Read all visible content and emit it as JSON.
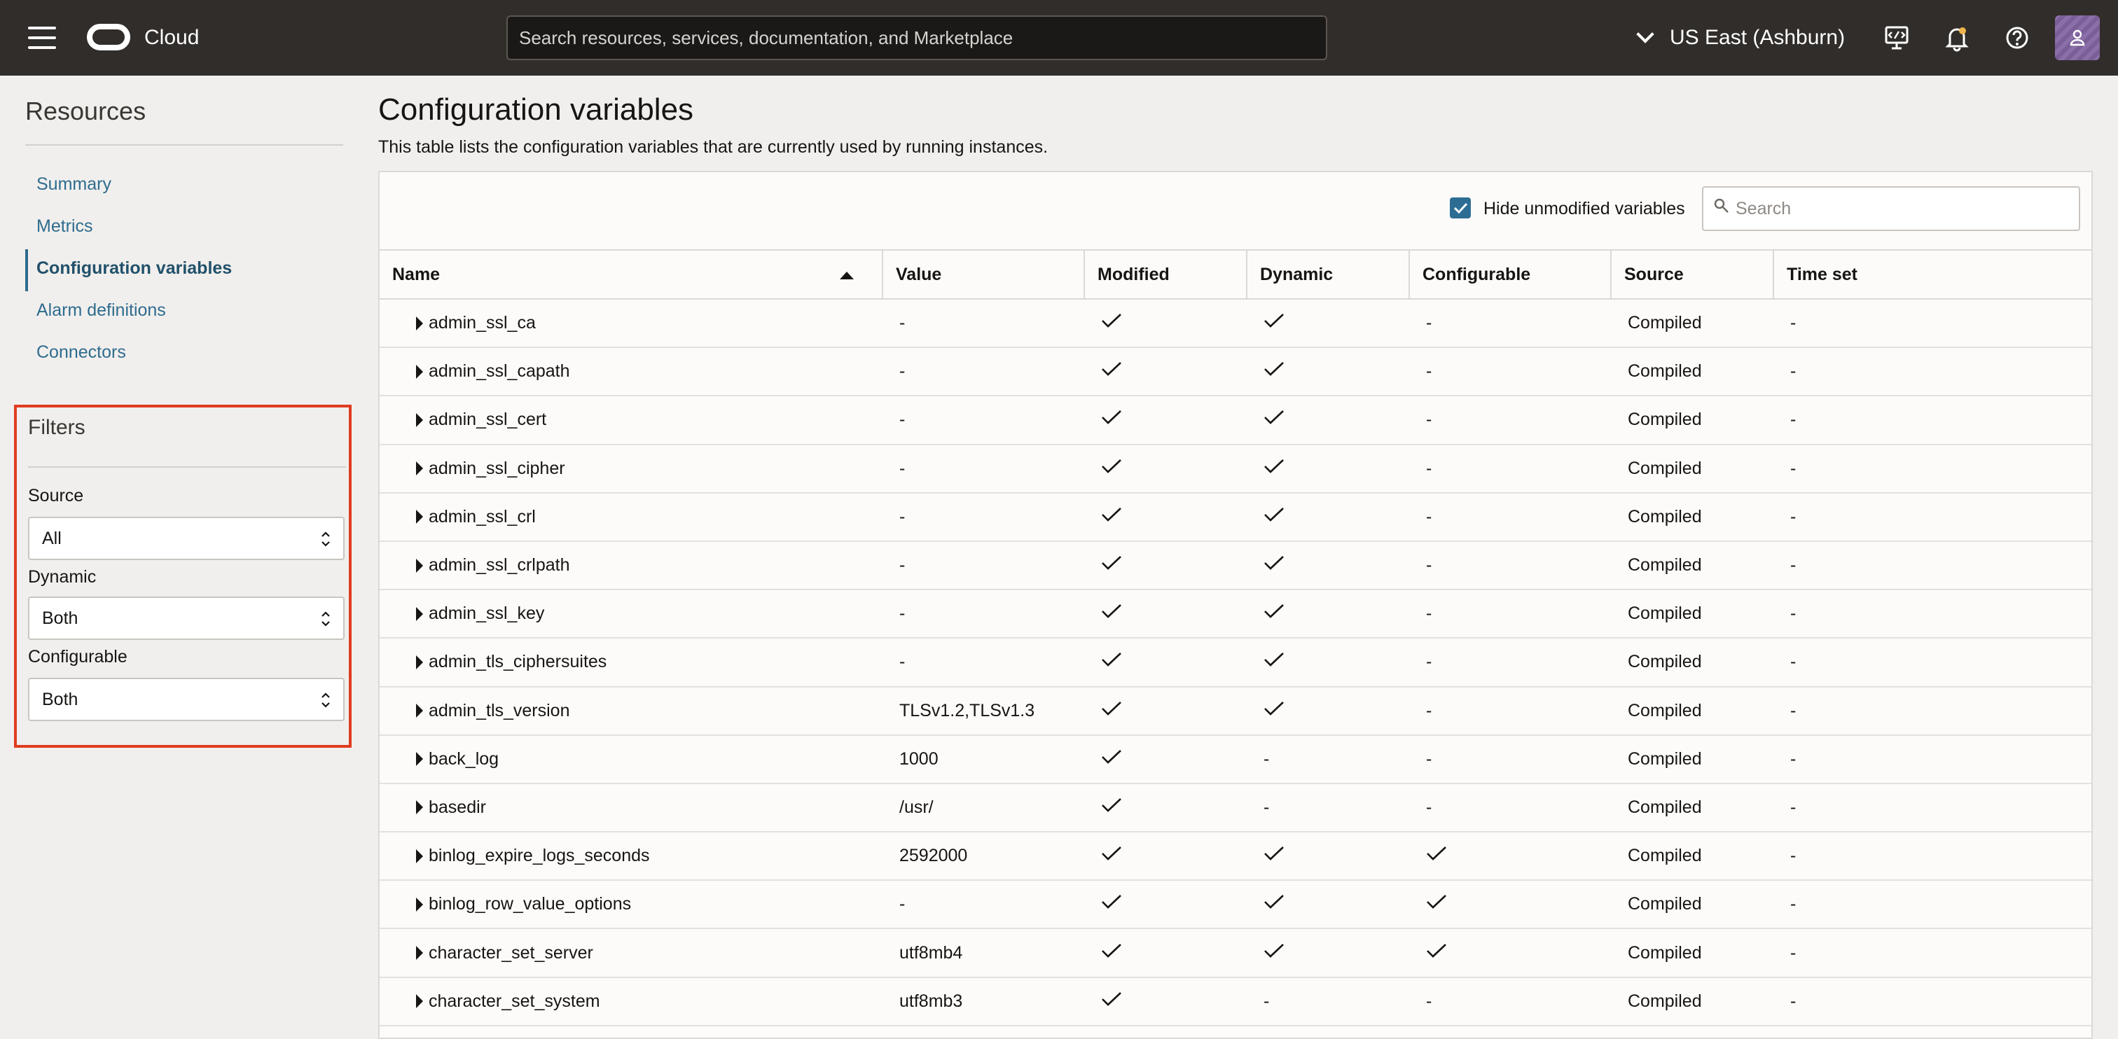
{
  "header": {
    "brand": "Cloud",
    "search_placeholder": "Search resources, services, documentation, and Marketplace",
    "region": "US East (Ashburn)",
    "icons": [
      "menu-icon",
      "oracle-logo-icon",
      "cloud-shell-icon",
      "bell-icon",
      "help-icon",
      "user-avatar-icon"
    ]
  },
  "sidebar": {
    "title": "Resources",
    "items": [
      {
        "label": "Summary",
        "active": false
      },
      {
        "label": "Metrics",
        "active": false
      },
      {
        "label": "Configuration variables",
        "active": true
      },
      {
        "label": "Alarm definitions",
        "active": false
      },
      {
        "label": "Connectors",
        "active": false
      }
    ],
    "filters": {
      "title": "Filters",
      "source_label": "Source",
      "source_value": "All",
      "dynamic_label": "Dynamic",
      "dynamic_value": "Both",
      "configurable_label": "Configurable",
      "configurable_value": "Both"
    }
  },
  "main": {
    "title": "Configuration variables",
    "description": "This table lists the configuration variables that are currently used by running instances.",
    "hide_unmodified_label": "Hide unmodified variables",
    "hide_unmodified_checked": true,
    "search_placeholder": "Search",
    "columns": [
      "Name",
      "Value",
      "Modified",
      "Dynamic",
      "Configurable",
      "Source",
      "Time set"
    ],
    "rows": [
      {
        "name": "admin_ssl_ca",
        "value": "-",
        "modified": true,
        "dynamic": true,
        "configurable": false,
        "source": "Compiled",
        "time_set": "-"
      },
      {
        "name": "admin_ssl_capath",
        "value": "-",
        "modified": true,
        "dynamic": true,
        "configurable": false,
        "source": "Compiled",
        "time_set": "-"
      },
      {
        "name": "admin_ssl_cert",
        "value": "-",
        "modified": true,
        "dynamic": true,
        "configurable": false,
        "source": "Compiled",
        "time_set": "-"
      },
      {
        "name": "admin_ssl_cipher",
        "value": "-",
        "modified": true,
        "dynamic": true,
        "configurable": false,
        "source": "Compiled",
        "time_set": "-"
      },
      {
        "name": "admin_ssl_crl",
        "value": "-",
        "modified": true,
        "dynamic": true,
        "configurable": false,
        "source": "Compiled",
        "time_set": "-"
      },
      {
        "name": "admin_ssl_crlpath",
        "value": "-",
        "modified": true,
        "dynamic": true,
        "configurable": false,
        "source": "Compiled",
        "time_set": "-"
      },
      {
        "name": "admin_ssl_key",
        "value": "-",
        "modified": true,
        "dynamic": true,
        "configurable": false,
        "source": "Compiled",
        "time_set": "-"
      },
      {
        "name": "admin_tls_ciphersuites",
        "value": "-",
        "modified": true,
        "dynamic": true,
        "configurable": false,
        "source": "Compiled",
        "time_set": "-"
      },
      {
        "name": "admin_tls_version",
        "value": "TLSv1.2,TLSv1.3",
        "modified": true,
        "dynamic": true,
        "configurable": false,
        "source": "Compiled",
        "time_set": "-"
      },
      {
        "name": "back_log",
        "value": "1000",
        "modified": true,
        "dynamic": false,
        "configurable": false,
        "source": "Compiled",
        "time_set": "-"
      },
      {
        "name": "basedir",
        "value": "/usr/",
        "modified": true,
        "dynamic": false,
        "configurable": false,
        "source": "Compiled",
        "time_set": "-"
      },
      {
        "name": "binlog_expire_logs_seconds",
        "value": "2592000",
        "modified": true,
        "dynamic": true,
        "configurable": true,
        "source": "Compiled",
        "time_set": "-"
      },
      {
        "name": "binlog_row_value_options",
        "value": "-",
        "modified": true,
        "dynamic": true,
        "configurable": true,
        "source": "Compiled",
        "time_set": "-"
      },
      {
        "name": "character_set_server",
        "value": "utf8mb4",
        "modified": true,
        "dynamic": true,
        "configurable": true,
        "source": "Compiled",
        "time_set": "-"
      },
      {
        "name": "character_set_system",
        "value": "utf8mb3",
        "modified": true,
        "dynamic": false,
        "configurable": false,
        "source": "Compiled",
        "time_set": "-"
      }
    ],
    "dash": "-"
  }
}
